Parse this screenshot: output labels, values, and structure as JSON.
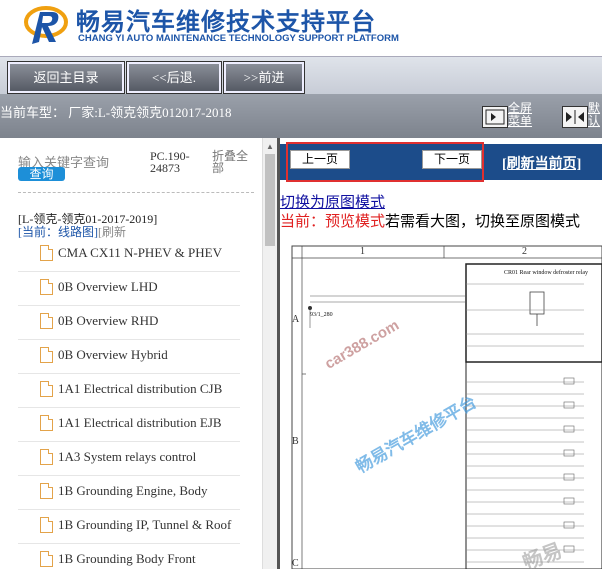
{
  "header": {
    "title_cn": "畅易汽车维修技术支持平台",
    "title_en": "CHANG YI AUTO MAINTENANCE TECHNOLOGY SUPPORT PLATFORM",
    "brand_color": "#1d55a8"
  },
  "toolbar": {
    "home_label": "返回主目录",
    "back_label": "<<后退.",
    "forward_label": ">>前进"
  },
  "carbar": {
    "current_vehicle": "当前车型： 厂家:L-领克领克012017-2018",
    "fullscreen_label": "全屏菜单",
    "default_label": "默认"
  },
  "sidebar": {
    "search_placeholder": "输入关键字查询",
    "search_button": "查询",
    "pc_version": "PC.190-24873",
    "collapse_label": "折叠全部",
    "vehicle_path": "[L-领克-领克01-2017-2019]",
    "current_label": "[当前：线路图]",
    "refresh_label": "[刷新",
    "items": [
      {
        "label": "CMA CX11 N-PHEV & PHEV"
      },
      {
        "label": "0B Overview LHD"
      },
      {
        "label": "0B Overview RHD"
      },
      {
        "label": "0B Overview Hybrid"
      },
      {
        "label": "1A1 Electrical distribution CJB"
      },
      {
        "label": "1A1 Electrical distribution EJB"
      },
      {
        "label": "1A3 System relays control"
      },
      {
        "label": "1B Grounding Engine, Body"
      },
      {
        "label": "1B Grounding IP, Tunnel & Roof"
      },
      {
        "label": "1B Grounding Body Front"
      }
    ]
  },
  "main": {
    "prev_page": "上一页",
    "next_page": "下一页",
    "refresh_page": "[刷新当前页]",
    "switch_mode": "切换为原图模式",
    "mode_current": "当前：预览模式",
    "mode_hint": "若需看大图，切换至原图模式",
    "accent_color": "#1c4c8a"
  },
  "diagram": {
    "col_1": "1",
    "col_2": "2",
    "row_a": "A",
    "row_b": "B",
    "row_c": "C",
    "relay_title": "CR01 Rear window defroster relay",
    "node_1": "93/1_280",
    "watermark_site": "car388.com",
    "watermark_cn": "畅易汽车维修平台",
    "watermark_cn2": "畅易"
  }
}
